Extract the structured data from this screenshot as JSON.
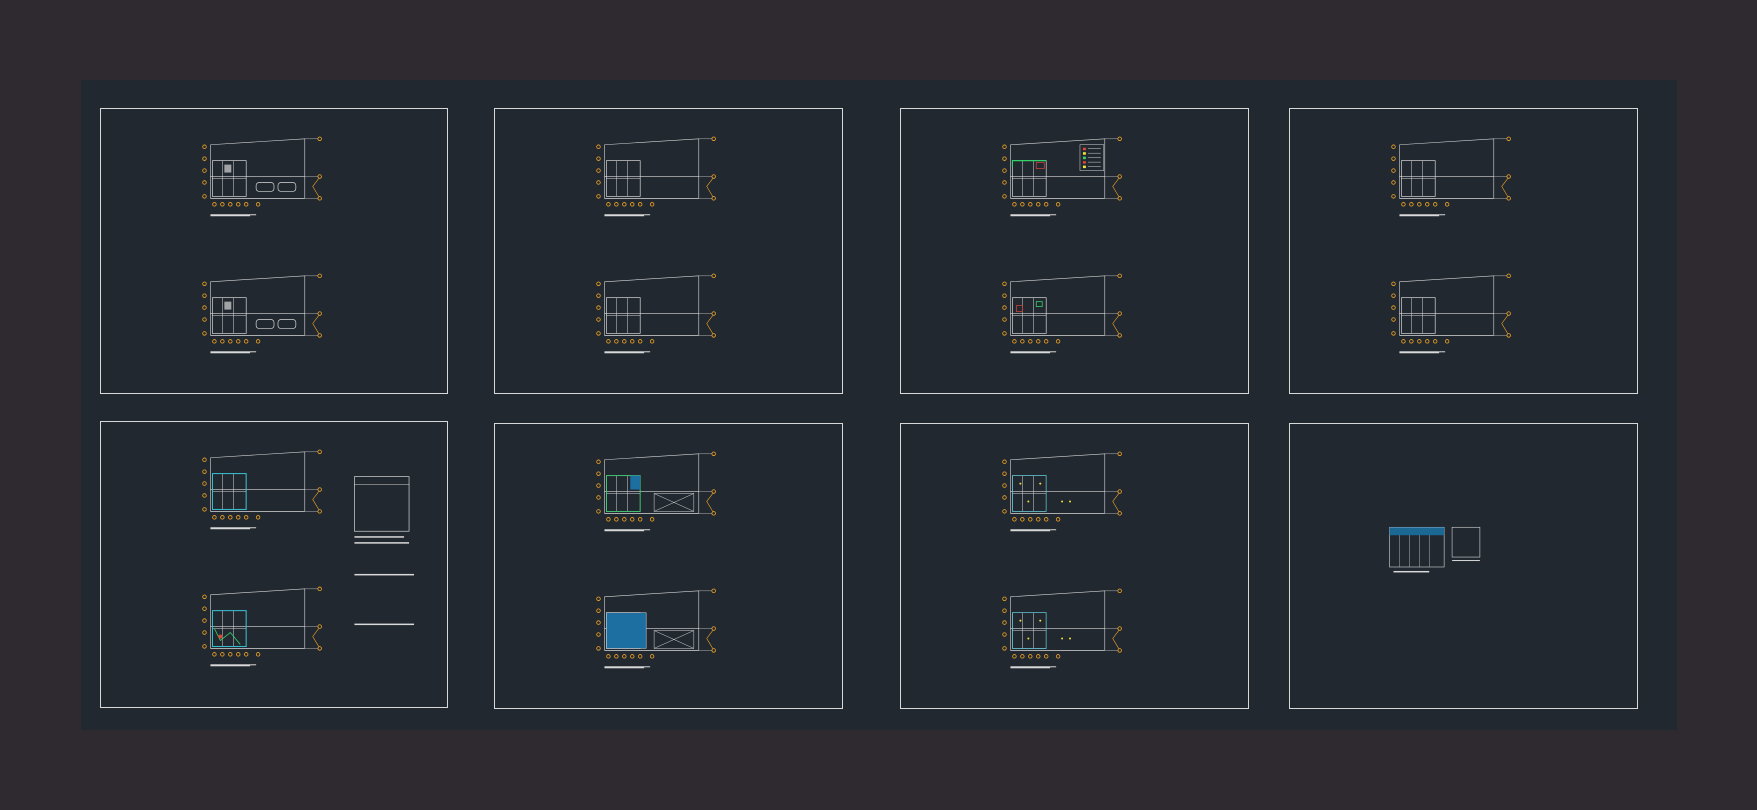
{
  "app": {
    "background_color": "#2f2930",
    "canvas_color": "#212830",
    "frame_color": "#d8d8d8"
  },
  "colors": {
    "line": "#d9d9d9",
    "grid_bubble": "#f5a623",
    "cyan": "#2bc4d8",
    "green": "#34d06a",
    "yellow": "#f2e23a",
    "red": "#e0443a",
    "blue_fill": "#1c6fa0"
  },
  "sheets": [
    {
      "name": "sheet-1",
      "plans": [
        "plan",
        "plan"
      ],
      "variant": "furniture"
    },
    {
      "name": "sheet-2",
      "plans": [
        "plan",
        "plan"
      ],
      "variant": "plain"
    },
    {
      "name": "sheet-3",
      "plans": [
        "plan",
        "plan"
      ],
      "variant": "legend"
    },
    {
      "name": "sheet-4",
      "plans": [
        "plan",
        "plan"
      ],
      "variant": "plain"
    },
    {
      "name": "sheet-5",
      "plans": [
        "plan",
        "plan"
      ],
      "variant": "details"
    },
    {
      "name": "sheet-6",
      "plans": [
        "plan",
        "plan"
      ],
      "variant": "structure"
    },
    {
      "name": "sheet-7",
      "plans": [
        "plan",
        "plan"
      ],
      "variant": "electrical"
    },
    {
      "name": "sheet-8",
      "plans": [
        "section"
      ],
      "variant": "section"
    }
  ]
}
